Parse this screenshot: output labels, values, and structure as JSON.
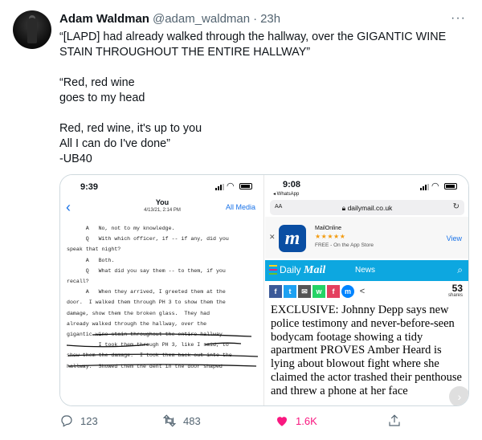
{
  "tweet": {
    "author_name": "Adam Waldman",
    "handle": "@adam_waldman",
    "separator": "·",
    "time": "23h",
    "more": "···",
    "text_lines": [
      "“[LAPD] had already walked through the hallway, over the GIGANTIC WINE STAIN THROUGHOUT THE ENTIRE HALLWAY”",
      "",
      "“Red, red wine",
      "goes to my head",
      "",
      "Red, red wine, it's up to you",
      "All I can do I've done”",
      "-UB40"
    ]
  },
  "left_screenshot": {
    "status_time": "9:39",
    "back": "‹",
    "title": "You",
    "subtitle": "4/13/21, 2:14 PM",
    "all_media": "All Media",
    "transcript_lines": [
      "      A   No, not to my knowledge.",
      "      Q   With which officer, if -- if any, did you",
      "speak that night?",
      "      A   Both.",
      "      Q   What did you say them -- to them, if you",
      "recall?",
      "      A   When they arrived, I greeted them at the",
      "door.  I walked them through PH 3 to show them the",
      "damage, show them the broken glass.  They had",
      "already walked through the hallway, over the",
      "gigantic wine stain throughout the entire hallway.",
      "          I took them through PH 3, like I said, to",
      "show them the damage.  I took them back out into the",
      "hallway.  Showed them the dent in the door shaped"
    ]
  },
  "right_screenshot": {
    "status_time": "9:08",
    "back_app": "◂ WhatsApp",
    "aa": "AA",
    "url": "dailymail.co.uk",
    "app_name": "MailOnline",
    "app_stars": "★★★★★",
    "app_sub": "FREE - On the App Store",
    "view": "View",
    "logo_prefix": "Daily",
    "logo_main": "Mail",
    "section": "News",
    "share_icons": [
      "f",
      "t",
      "✉",
      "w",
      "f",
      "m"
    ],
    "shares_count": "53",
    "shares_label": "shares",
    "headline": "EXCLUSIVE: Johnny Depp says new police testimony and never-before-seen bodycam footage showing a tidy apartment PROVES Amber Heard is lying about blowout fight where she claimed the actor trashed their penthouse and threw a phone at her face"
  },
  "actions": {
    "replies": "123",
    "retweets": "483",
    "likes": "1.6K"
  },
  "colors": {
    "like": "#f91880",
    "retweet": "#536471",
    "link": "#1a73e8",
    "dm_blue": "#0da7e0"
  }
}
